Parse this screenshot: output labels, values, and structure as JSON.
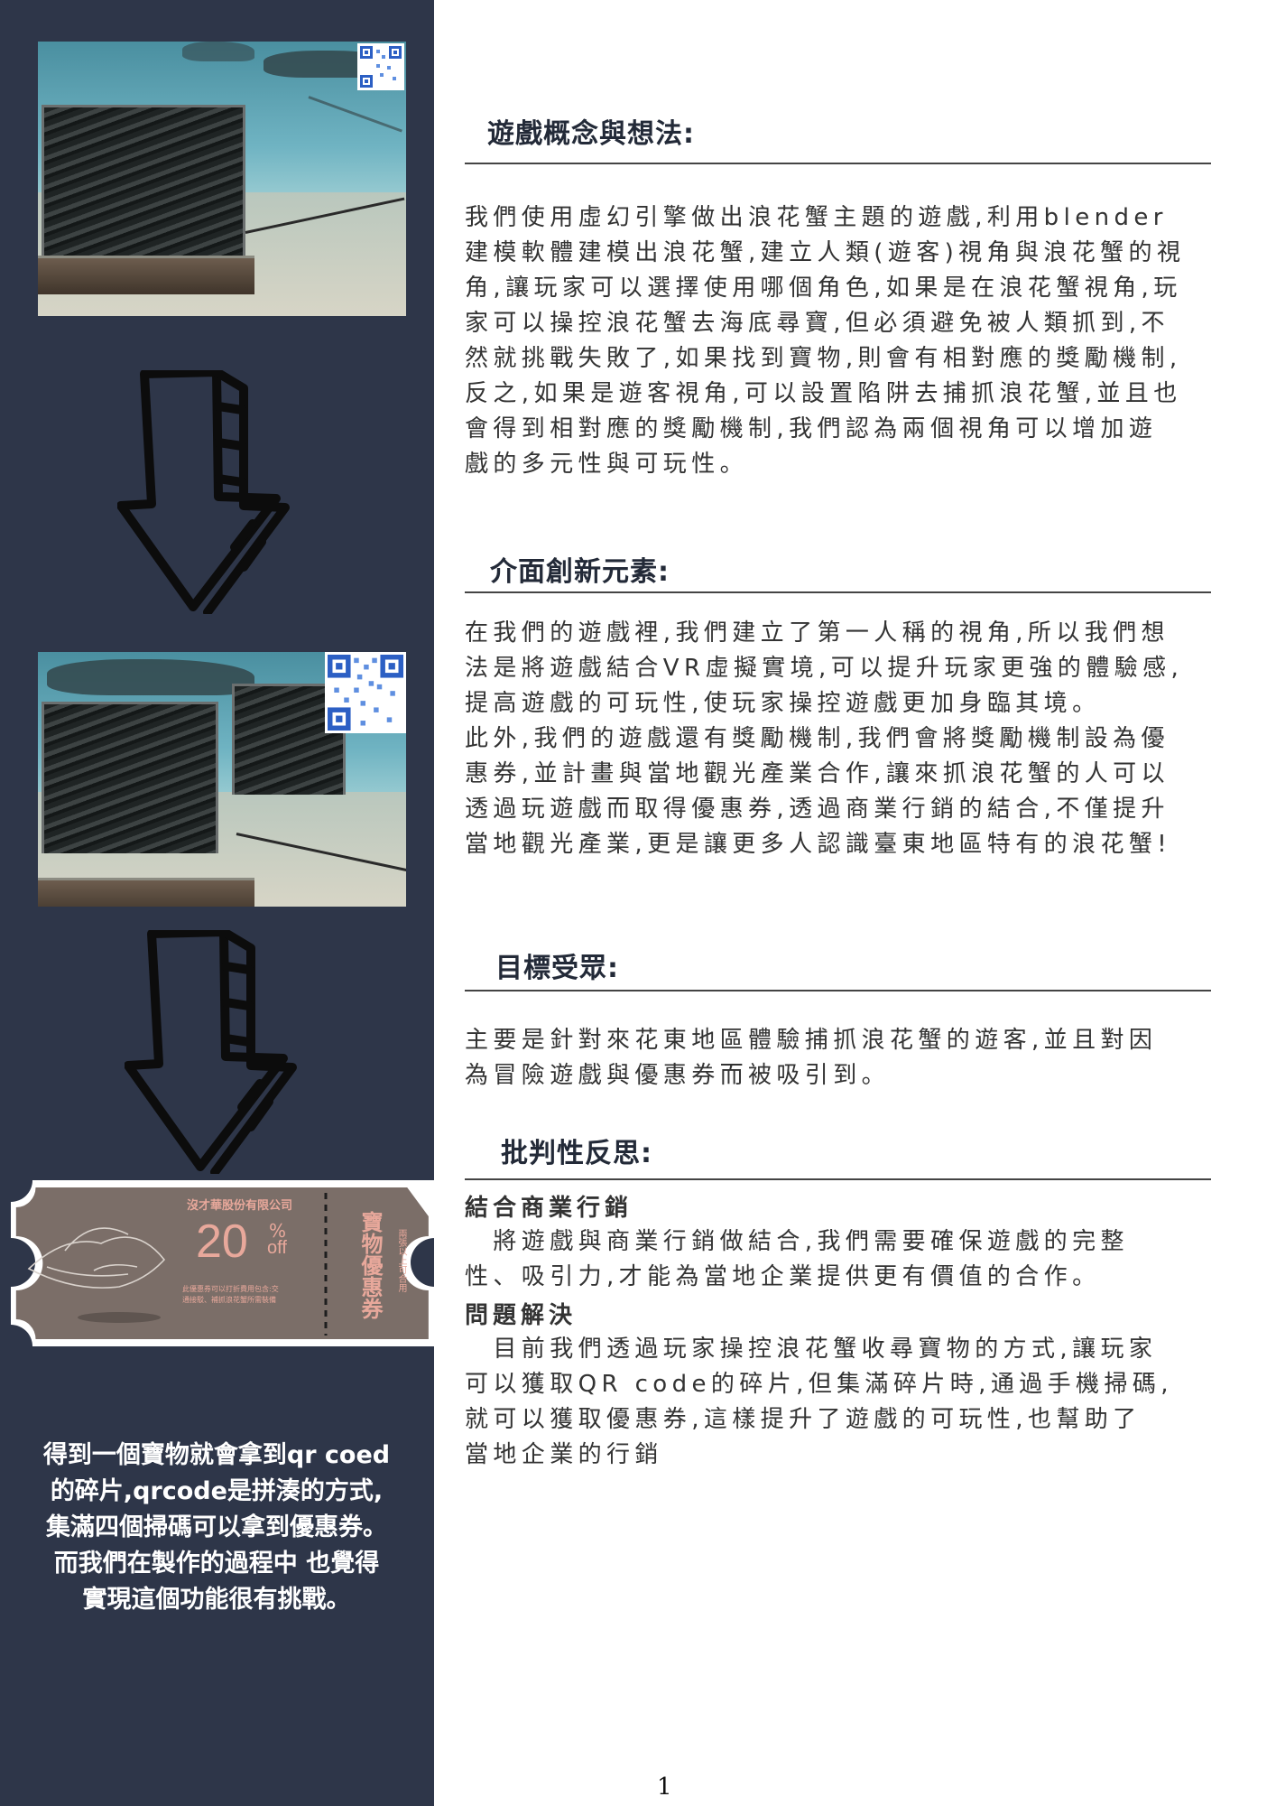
{
  "sections": [
    {
      "heading": "遊戲概念與想法:",
      "body": "我們使用虛幻引擎做出浪花蟹主題的遊戲,利用blender\n建模軟體建模出浪花蟹,建立人類(遊客)視角與浪花蟹的視\n角,讓玩家可以選擇使用哪個角色,如果是在浪花蟹視角,玩\n家可以操控浪花蟹去海底尋寶,但必須避免被人類抓到,不\n然就挑戰失敗了,如果找到寶物,則會有相對應的獎勵機制,\n反之,如果是遊客視角,可以設置陷阱去捕抓浪花蟹,並且也\n會得到相對應的獎勵機制,我們認為兩個視角可以增加遊\n戲的多元性與可玩性。"
    },
    {
      "heading": "介面創新元素:",
      "body": "在我們的遊戲裡,我們建立了第一人稱的視角,所以我們想\n法是將遊戲結合VR虛擬實境,可以提升玩家更強的體驗感,\n提高遊戲的可玩性,使玩家操控遊戲更加身臨其境。\n 此外,我們的遊戲還有獎勵機制,我們會將獎勵機制設為優\n惠券,並計畫與當地觀光產業合作,讓來抓浪花蟹的人可以\n透過玩遊戲而取得優惠券,透過商業行銷的結合,不僅提升\n當地觀光產業,更是讓更多人認識臺東地區特有的浪花蟹!"
    },
    {
      "heading": "目標受眾:",
      "body": "主要是針對來花東地區體驗捕抓浪花蟹的遊客,並且對因\n為冒險遊戲與優惠券而被吸引到。"
    },
    {
      "heading": "批判性反思:",
      "sub1": "結合商業行銷",
      "body1": "　將遊戲與商業行銷做結合,我們需要確保遊戲的完整\n性、吸引力,才能為當地企業提供更有價值的合作。",
      "sub2": "問題解決",
      "body2": "　目前我們透過玩家操控浪花蟹收尋寶物的方式,讓玩家\n可以獲取QR code的碎片,但集滿碎片時,通過手機掃碼,\n就可以獲取優惠券,這樣提升了遊戲的可玩性,也幫助了\n當地企業的行銷"
    }
  ],
  "sidebar": {
    "caption": "得到一個寶物就會拿到qr coed\n的碎片,qrcode是拼湊的方式,\n集滿四個掃碼可以拿到優惠券。\n而我們在製作的過程中 也覺得\n實現這個功能很有挑戰。"
  },
  "coupon": {
    "company": "沒才華股份有限公司",
    "discount": "20",
    "percent": "%",
    "off": "off",
    "note1": "此優惠券可以打折費用包含:交",
    "note2": "通接駁、補抓浪花蟹所需裝備",
    "title": "寶物優惠券",
    "subtitle": "兩張以上可合用"
  },
  "page_number": "1",
  "colors": {
    "sidebar": "#2e3649",
    "coupon": "#7b6e68",
    "coupon_text": "#e8a89b"
  }
}
